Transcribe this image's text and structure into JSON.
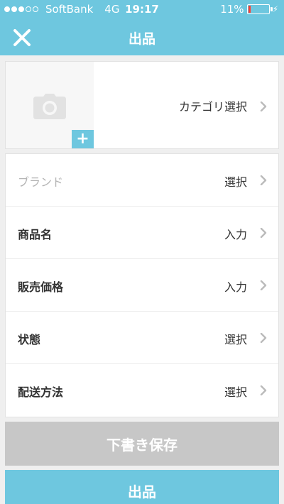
{
  "status_bar": {
    "carrier": "SoftBank",
    "network": "4G",
    "time": "19:17",
    "battery_percent": "11%",
    "battery_level": 0.11,
    "signal_bars_filled": 3,
    "signal_bars_total": 5
  },
  "nav": {
    "title": "出品",
    "close_icon": "close-icon"
  },
  "photo": {
    "camera_icon": "camera-icon",
    "add_label": "+"
  },
  "category": {
    "label": "カテゴリ選択"
  },
  "form": {
    "rows": [
      {
        "label": "ブランド",
        "value": "選択",
        "muted": true
      },
      {
        "label": "商品名",
        "value": "入力",
        "muted": false
      },
      {
        "label": "販売価格",
        "value": "入力",
        "muted": false
      },
      {
        "label": "状態",
        "value": "選択",
        "muted": false
      },
      {
        "label": "配送方法",
        "value": "選択",
        "muted": false
      }
    ]
  },
  "buttons": {
    "draft": "下書き保存",
    "submit": "出品"
  },
  "colors": {
    "accent": "#6ec7df",
    "disabled": "#c7c7c7",
    "battery_low": "#ff3b30"
  }
}
